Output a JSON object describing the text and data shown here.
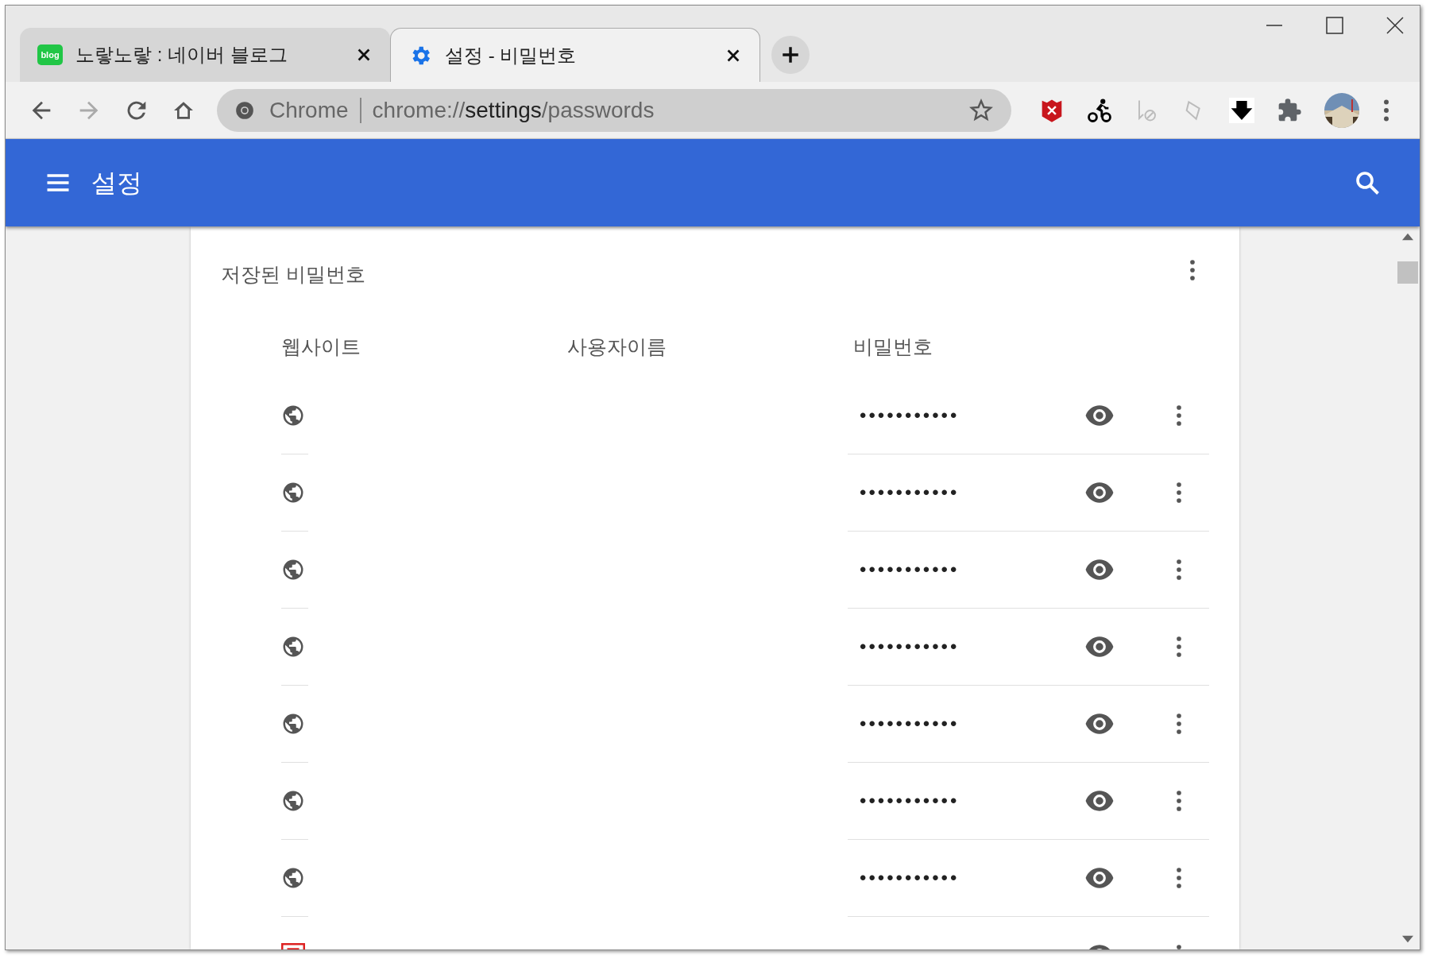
{
  "tabs": [
    {
      "label": "노랗노랗 : 네이버 블로그",
      "kind": "blog",
      "icon_text": "blog",
      "selected": false
    },
    {
      "label": "설정 - 비밀번호",
      "kind": "settings",
      "selected": true
    }
  ],
  "address_bar": {
    "origin": "Chrome",
    "url_plain": "chrome://",
    "url_host": "settings",
    "url_path": "/passwords"
  },
  "header": {
    "title": "설정"
  },
  "section": {
    "title": "저장된 비밀번호",
    "columns": [
      "웹사이트",
      "사용자이름",
      "비밀번호"
    ],
    "rows": [
      {
        "kind": "globe",
        "password": "•••••••••••"
      },
      {
        "kind": "globe",
        "password": "•••••••••••"
      },
      {
        "kind": "globe",
        "password": "•••••••••••"
      },
      {
        "kind": "globe",
        "password": "•••••••••••"
      },
      {
        "kind": "globe",
        "password": "•••••••••••"
      },
      {
        "kind": "globe",
        "password": "•••••••••••"
      },
      {
        "kind": "globe",
        "password": "•••••••••••"
      },
      {
        "kind": "favicon"
      }
    ]
  }
}
